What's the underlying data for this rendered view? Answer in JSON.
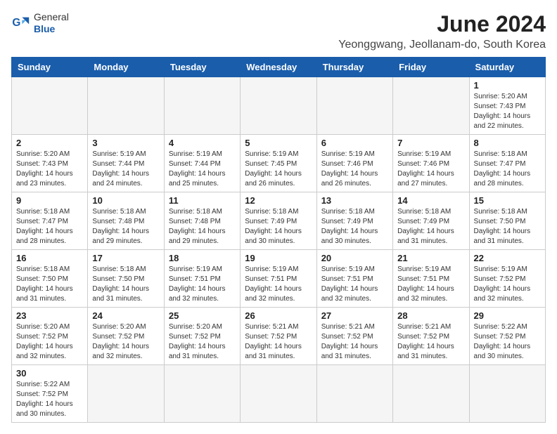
{
  "header": {
    "logo_general": "General",
    "logo_blue": "Blue",
    "month_year": "June 2024",
    "location": "Yeonggwang, Jeollanam-do, South Korea"
  },
  "weekdays": [
    "Sunday",
    "Monday",
    "Tuesday",
    "Wednesday",
    "Thursday",
    "Friday",
    "Saturday"
  ],
  "weeks": [
    [
      {
        "day": "",
        "sunrise": "",
        "sunset": "",
        "daylight": "",
        "empty": true
      },
      {
        "day": "",
        "sunrise": "",
        "sunset": "",
        "daylight": "",
        "empty": true
      },
      {
        "day": "",
        "sunrise": "",
        "sunset": "",
        "daylight": "",
        "empty": true
      },
      {
        "day": "",
        "sunrise": "",
        "sunset": "",
        "daylight": "",
        "empty": true
      },
      {
        "day": "",
        "sunrise": "",
        "sunset": "",
        "daylight": "",
        "empty": true
      },
      {
        "day": "",
        "sunrise": "",
        "sunset": "",
        "daylight": "",
        "empty": true
      },
      {
        "day": "1",
        "sunrise": "Sunrise: 5:20 AM",
        "sunset": "Sunset: 7:43 PM",
        "daylight": "Daylight: 14 hours and 22 minutes.",
        "empty": false
      }
    ],
    [
      {
        "day": "2",
        "sunrise": "Sunrise: 5:20 AM",
        "sunset": "Sunset: 7:43 PM",
        "daylight": "Daylight: 14 hours and 23 minutes.",
        "empty": false
      },
      {
        "day": "3",
        "sunrise": "Sunrise: 5:19 AM",
        "sunset": "Sunset: 7:44 PM",
        "daylight": "Daylight: 14 hours and 24 minutes.",
        "empty": false
      },
      {
        "day": "4",
        "sunrise": "Sunrise: 5:19 AM",
        "sunset": "Sunset: 7:44 PM",
        "daylight": "Daylight: 14 hours and 25 minutes.",
        "empty": false
      },
      {
        "day": "5",
        "sunrise": "Sunrise: 5:19 AM",
        "sunset": "Sunset: 7:45 PM",
        "daylight": "Daylight: 14 hours and 26 minutes.",
        "empty": false
      },
      {
        "day": "6",
        "sunrise": "Sunrise: 5:19 AM",
        "sunset": "Sunset: 7:46 PM",
        "daylight": "Daylight: 14 hours and 26 minutes.",
        "empty": false
      },
      {
        "day": "7",
        "sunrise": "Sunrise: 5:19 AM",
        "sunset": "Sunset: 7:46 PM",
        "daylight": "Daylight: 14 hours and 27 minutes.",
        "empty": false
      },
      {
        "day": "8",
        "sunrise": "Sunrise: 5:18 AM",
        "sunset": "Sunset: 7:47 PM",
        "daylight": "Daylight: 14 hours and 28 minutes.",
        "empty": false
      }
    ],
    [
      {
        "day": "9",
        "sunrise": "Sunrise: 5:18 AM",
        "sunset": "Sunset: 7:47 PM",
        "daylight": "Daylight: 14 hours and 28 minutes.",
        "empty": false
      },
      {
        "day": "10",
        "sunrise": "Sunrise: 5:18 AM",
        "sunset": "Sunset: 7:48 PM",
        "daylight": "Daylight: 14 hours and 29 minutes.",
        "empty": false
      },
      {
        "day": "11",
        "sunrise": "Sunrise: 5:18 AM",
        "sunset": "Sunset: 7:48 PM",
        "daylight": "Daylight: 14 hours and 29 minutes.",
        "empty": false
      },
      {
        "day": "12",
        "sunrise": "Sunrise: 5:18 AM",
        "sunset": "Sunset: 7:49 PM",
        "daylight": "Daylight: 14 hours and 30 minutes.",
        "empty": false
      },
      {
        "day": "13",
        "sunrise": "Sunrise: 5:18 AM",
        "sunset": "Sunset: 7:49 PM",
        "daylight": "Daylight: 14 hours and 30 minutes.",
        "empty": false
      },
      {
        "day": "14",
        "sunrise": "Sunrise: 5:18 AM",
        "sunset": "Sunset: 7:49 PM",
        "daylight": "Daylight: 14 hours and 31 minutes.",
        "empty": false
      },
      {
        "day": "15",
        "sunrise": "Sunrise: 5:18 AM",
        "sunset": "Sunset: 7:50 PM",
        "daylight": "Daylight: 14 hours and 31 minutes.",
        "empty": false
      }
    ],
    [
      {
        "day": "16",
        "sunrise": "Sunrise: 5:18 AM",
        "sunset": "Sunset: 7:50 PM",
        "daylight": "Daylight: 14 hours and 31 minutes.",
        "empty": false
      },
      {
        "day": "17",
        "sunrise": "Sunrise: 5:18 AM",
        "sunset": "Sunset: 7:50 PM",
        "daylight": "Daylight: 14 hours and 31 minutes.",
        "empty": false
      },
      {
        "day": "18",
        "sunrise": "Sunrise: 5:19 AM",
        "sunset": "Sunset: 7:51 PM",
        "daylight": "Daylight: 14 hours and 32 minutes.",
        "empty": false
      },
      {
        "day": "19",
        "sunrise": "Sunrise: 5:19 AM",
        "sunset": "Sunset: 7:51 PM",
        "daylight": "Daylight: 14 hours and 32 minutes.",
        "empty": false
      },
      {
        "day": "20",
        "sunrise": "Sunrise: 5:19 AM",
        "sunset": "Sunset: 7:51 PM",
        "daylight": "Daylight: 14 hours and 32 minutes.",
        "empty": false
      },
      {
        "day": "21",
        "sunrise": "Sunrise: 5:19 AM",
        "sunset": "Sunset: 7:51 PM",
        "daylight": "Daylight: 14 hours and 32 minutes.",
        "empty": false
      },
      {
        "day": "22",
        "sunrise": "Sunrise: 5:19 AM",
        "sunset": "Sunset: 7:52 PM",
        "daylight": "Daylight: 14 hours and 32 minutes.",
        "empty": false
      }
    ],
    [
      {
        "day": "23",
        "sunrise": "Sunrise: 5:20 AM",
        "sunset": "Sunset: 7:52 PM",
        "daylight": "Daylight: 14 hours and 32 minutes.",
        "empty": false
      },
      {
        "day": "24",
        "sunrise": "Sunrise: 5:20 AM",
        "sunset": "Sunset: 7:52 PM",
        "daylight": "Daylight: 14 hours and 32 minutes.",
        "empty": false
      },
      {
        "day": "25",
        "sunrise": "Sunrise: 5:20 AM",
        "sunset": "Sunset: 7:52 PM",
        "daylight": "Daylight: 14 hours and 31 minutes.",
        "empty": false
      },
      {
        "day": "26",
        "sunrise": "Sunrise: 5:21 AM",
        "sunset": "Sunset: 7:52 PM",
        "daylight": "Daylight: 14 hours and 31 minutes.",
        "empty": false
      },
      {
        "day": "27",
        "sunrise": "Sunrise: 5:21 AM",
        "sunset": "Sunset: 7:52 PM",
        "daylight": "Daylight: 14 hours and 31 minutes.",
        "empty": false
      },
      {
        "day": "28",
        "sunrise": "Sunrise: 5:21 AM",
        "sunset": "Sunset: 7:52 PM",
        "daylight": "Daylight: 14 hours and 31 minutes.",
        "empty": false
      },
      {
        "day": "29",
        "sunrise": "Sunrise: 5:22 AM",
        "sunset": "Sunset: 7:52 PM",
        "daylight": "Daylight: 14 hours and 30 minutes.",
        "empty": false
      }
    ],
    [
      {
        "day": "30",
        "sunrise": "Sunrise: 5:22 AM",
        "sunset": "Sunset: 7:52 PM",
        "daylight": "Daylight: 14 hours and 30 minutes.",
        "empty": false
      },
      {
        "day": "",
        "sunrise": "",
        "sunset": "",
        "daylight": "",
        "empty": true
      },
      {
        "day": "",
        "sunrise": "",
        "sunset": "",
        "daylight": "",
        "empty": true
      },
      {
        "day": "",
        "sunrise": "",
        "sunset": "",
        "daylight": "",
        "empty": true
      },
      {
        "day": "",
        "sunrise": "",
        "sunset": "",
        "daylight": "",
        "empty": true
      },
      {
        "day": "",
        "sunrise": "",
        "sunset": "",
        "daylight": "",
        "empty": true
      },
      {
        "day": "",
        "sunrise": "",
        "sunset": "",
        "daylight": "",
        "empty": true
      }
    ]
  ]
}
